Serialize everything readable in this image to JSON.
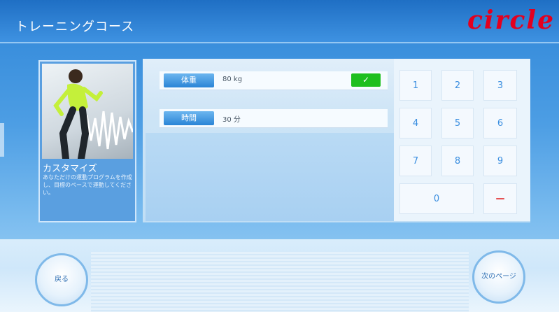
{
  "header": {
    "title": "トレーニングコース",
    "logo": "circle"
  },
  "card": {
    "title": "カスタマイズ",
    "description": "あなただけの運動プログラムを作成し、目標のペースで運動してください。"
  },
  "form": {
    "weight": {
      "label": "体重",
      "value": "80 kg"
    },
    "time": {
      "label": "時間",
      "value": "30 分"
    },
    "confirm_icon": "check-icon"
  },
  "keypad": {
    "keys": [
      "1",
      "2",
      "3",
      "4",
      "5",
      "6",
      "7",
      "8",
      "9",
      "0",
      "—"
    ]
  },
  "footer": {
    "back_label": "戻る",
    "next_label": "次のページ"
  },
  "colors": {
    "accent": "#2a84d6",
    "logo": "#e3001f",
    "confirm": "#1ebf1e",
    "delete": "#e12020"
  }
}
